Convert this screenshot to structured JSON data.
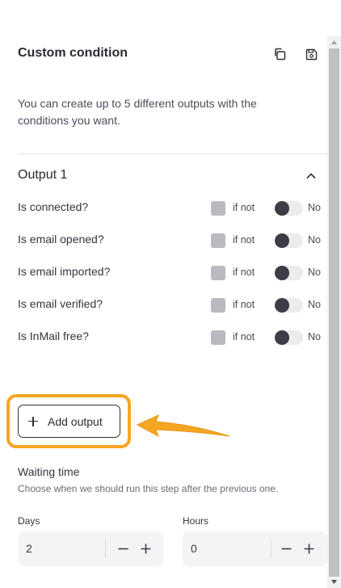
{
  "header": {
    "title": "Custom condition",
    "copy_icon": "copy-icon",
    "save_icon": "save-icon"
  },
  "description": "You can create up to 5 different outputs with the conditions you want.",
  "output": {
    "title": "Output 1",
    "collapse_icon": "chevron-up-icon",
    "conditions": [
      {
        "label": "Is connected?",
        "checkbox_label": "if not",
        "toggle_label": "No"
      },
      {
        "label": "Is email opened?",
        "checkbox_label": "if not",
        "toggle_label": "No"
      },
      {
        "label": "Is email imported?",
        "checkbox_label": "if not",
        "toggle_label": "No"
      },
      {
        "label": "Is email verified?",
        "checkbox_label": "if not",
        "toggle_label": "No"
      },
      {
        "label": "Is InMail free?",
        "checkbox_label": "if not",
        "toggle_label": "No"
      }
    ]
  },
  "add_output": {
    "label": "Add output"
  },
  "waiting": {
    "title": "Waiting time",
    "description": "Choose when we should run this step after the previous one.",
    "days": {
      "label": "Days",
      "value": "2"
    },
    "hours": {
      "label": "Hours",
      "value": "0"
    }
  },
  "colors": {
    "highlight": "#f5a623",
    "toggle_knob": "#3d3d47",
    "checkbox": "#b9b9c0"
  }
}
